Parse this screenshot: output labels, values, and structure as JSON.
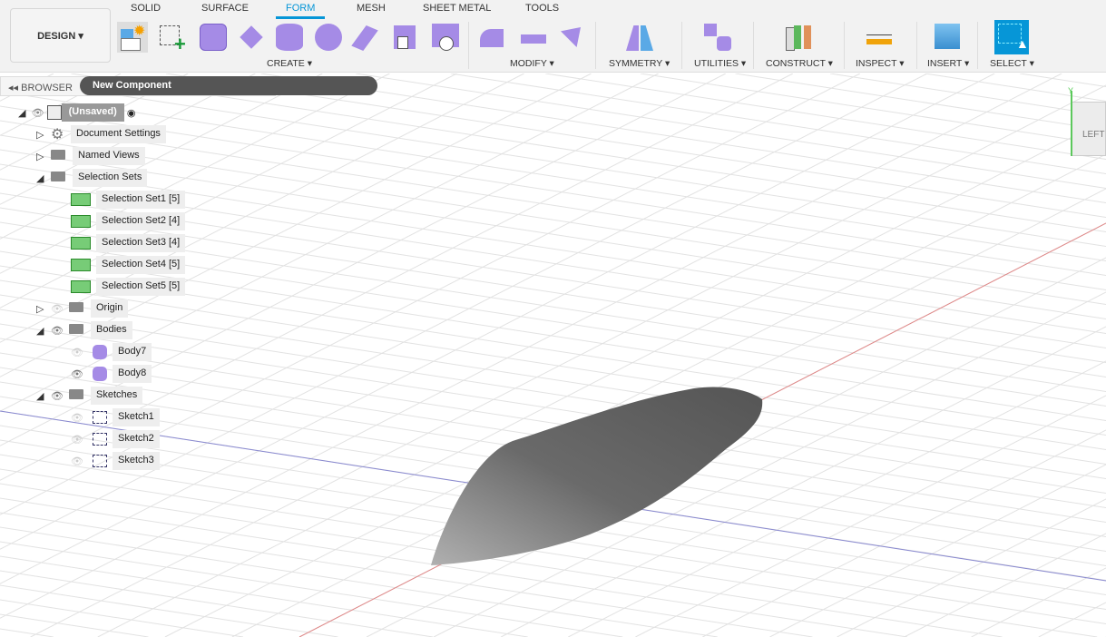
{
  "toolbar": {
    "workspace": "DESIGN ▾",
    "tabs": [
      "SOLID",
      "SURFACE",
      "FORM",
      "MESH",
      "SHEET METAL",
      "TOOLS"
    ],
    "active_tab": "FORM",
    "groups": [
      "CREATE ▾",
      "MODIFY ▾",
      "SYMMETRY ▾",
      "UTILITIES ▾",
      "CONSTRUCT ▾",
      "INSPECT ▾",
      "INSERT ▾",
      "SELECT ▾"
    ]
  },
  "browser": {
    "title": "BROWSER",
    "component": "New Component",
    "root": "(Unsaved)",
    "items": [
      {
        "label": "Document Settings"
      },
      {
        "label": "Named Views"
      },
      {
        "label": "Selection Sets"
      },
      {
        "label": "Selection Set1 [5]"
      },
      {
        "label": "Selection Set2 [4]"
      },
      {
        "label": "Selection Set3 [4]"
      },
      {
        "label": "Selection Set4 [5]"
      },
      {
        "label": "Selection Set5 [5]"
      },
      {
        "label": "Origin"
      },
      {
        "label": "Bodies"
      },
      {
        "label": "Body7"
      },
      {
        "label": "Body8"
      },
      {
        "label": "Sketches"
      },
      {
        "label": "Sketch1"
      },
      {
        "label": "Sketch2"
      },
      {
        "label": "Sketch3"
      }
    ]
  },
  "viewcube": {
    "face": "LEFT",
    "axis": "Y"
  },
  "colors": {
    "accent": "#0696d7",
    "form": "#9b7de0"
  }
}
